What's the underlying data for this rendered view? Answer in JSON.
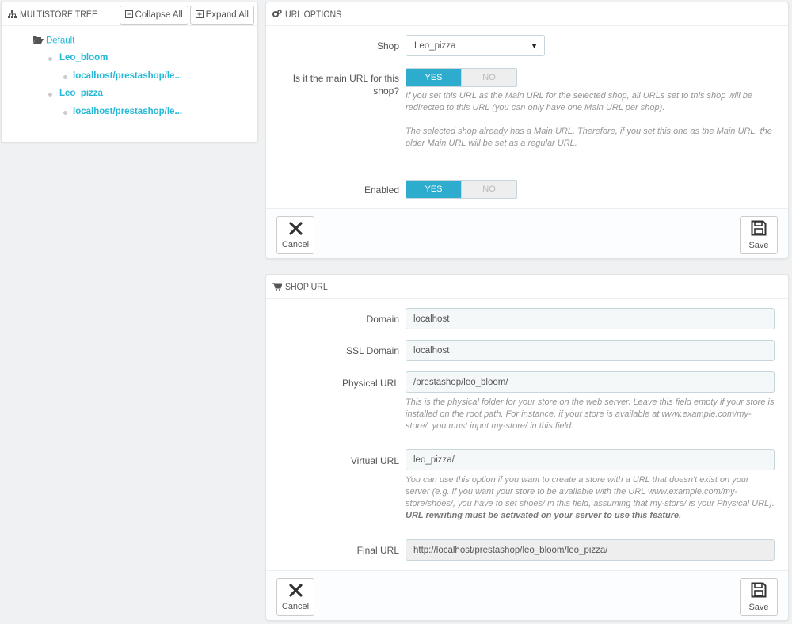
{
  "tree": {
    "title": "MULTISTORE TREE",
    "collapse_label": "Collapse All",
    "expand_label": "Expand All",
    "group": "Default",
    "shops": [
      {
        "name": "Leo_bloom",
        "url": "localhost/prestashop/le..."
      },
      {
        "name": "Leo_pizza",
        "url": "localhost/prestashop/le..."
      }
    ]
  },
  "url_options": {
    "title": "URL OPTIONS",
    "shop_label": "Shop",
    "shop_value": "Leo_pizza",
    "main_label_1": "Is it the main URL for this",
    "main_label_2": "shop?",
    "yes": "YES",
    "no": "NO",
    "main_help_1": "If you set this URL as the Main URL for the selected shop, all URLs set to this shop will be redirected to this URL (you can only have one Main URL per shop).",
    "main_help_2": "The selected shop already has a Main URL. Therefore, if you set this one as the Main URL, the older Main URL will be set as a regular URL.",
    "enabled_label": "Enabled",
    "main_value": "YES",
    "enabled_value": "YES",
    "cancel": "Cancel",
    "save": "Save"
  },
  "shop_url": {
    "title": "SHOP URL",
    "domain_label": "Domain",
    "domain_value": "localhost",
    "ssl_label": "SSL Domain",
    "ssl_value": "localhost",
    "physical_label": "Physical URL",
    "physical_value": "/prestashop/leo_bloom/",
    "physical_help": "This is the physical folder for your store on the web server. Leave this field empty if your store is installed on the root path. For instance, if your store is available at www.example.com/my-store/, you must input my-store/ in this field.",
    "virtual_label": "Virtual URL",
    "virtual_value": "leo_pizza/",
    "virtual_help": "You can use this option if you want to create a store with a URL that doesn't exist on your server (e.g. if you want your store to be available with the URL www.example.com/my-store/shoes/, you have to set shoes/ in this field, assuming that my-store/ is your Physical URL).",
    "virtual_help_bold": "URL rewriting must be activated on your server to use this feature.",
    "final_label": "Final URL",
    "final_value": "http://localhost/prestashop/leo_bloom/leo_pizza/",
    "cancel": "Cancel",
    "save": "Save"
  },
  "colors": {
    "accent": "#2eacce",
    "link": "#25b9d7"
  }
}
